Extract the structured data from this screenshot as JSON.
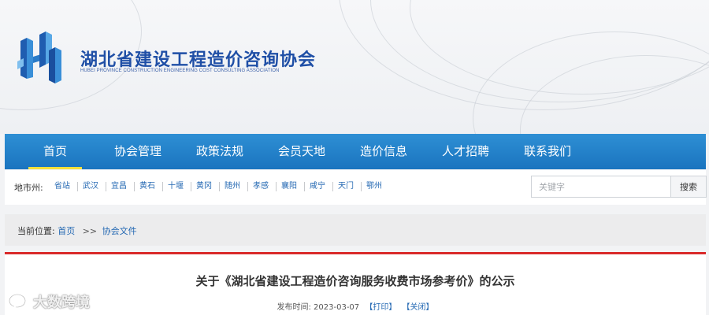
{
  "header": {
    "title": "湖北省建设工程造价咨询协会",
    "subtitle": "HUBEI PROVINCE CONSTRUCTION ENGINEERING COST CONSULTING ASSOCIATION",
    "brand_color": "#1f4fa6"
  },
  "nav": {
    "items": [
      {
        "label": "首页",
        "active": true
      },
      {
        "label": "协会管理"
      },
      {
        "label": "政策法规"
      },
      {
        "label": "会员天地"
      },
      {
        "label": "造价信息"
      },
      {
        "label": "人才招聘"
      },
      {
        "label": "联系我们"
      }
    ],
    "bg_color": "#1f7fc8",
    "active_color": "#f5e03b"
  },
  "citybar": {
    "label": "地市州:",
    "cities": [
      "省站",
      "武汉",
      "宜昌",
      "黄石",
      "十堰",
      "黄冈",
      "随州",
      "孝感",
      "襄阳",
      "咸宁",
      "天门",
      "鄂州"
    ],
    "search_placeholder": "关键字",
    "search_button": "搜索"
  },
  "breadcrumb": {
    "label": "当前位置:",
    "home": "首页",
    "separator": ">>",
    "current": "协会文件"
  },
  "article": {
    "title": "关于《湖北省建设工程造价咨询服务收费市场参考价》的公示",
    "date_label": "发布时间:",
    "date": "2023-03-07",
    "print_label": "【打印】",
    "close_label": "【关闭】",
    "accent_color": "#d92a2a"
  },
  "watermark": {
    "text": "大数跨境",
    "icon": "chat-bubble-icon"
  }
}
